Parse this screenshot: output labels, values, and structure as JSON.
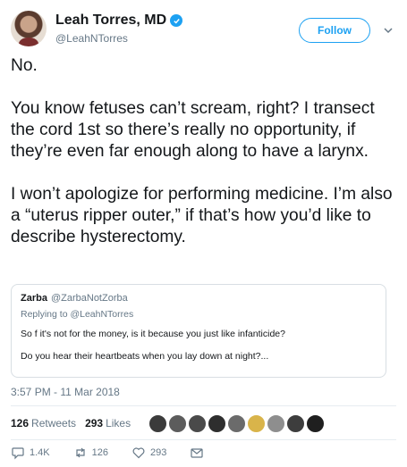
{
  "author": {
    "display_name": "Leah Torres, MD",
    "handle": "@LeahNTorres",
    "verified": true,
    "follow_label": "Follow"
  },
  "tweet": {
    "paragraphs": [
      "No.",
      "You know fetuses can’t scream, right? I transect the cord 1st so there’s really no opportunity, if they’re even far enough along to have a larynx.",
      "I won’t apologize for performing medicine. I’m also a “uterus ripper outer,” if that’s how you’d like to describe hysterectomy."
    ],
    "timestamp": "3:57 PM - 11 Mar 2018"
  },
  "quoted_tweet": {
    "display_name": "Zarba",
    "handle": "@ZarbaNotZorba",
    "replying_to": "Replying to @LeahNTorres",
    "line1": "So f it's not for the money, is it because you just like infanticide?",
    "line2": "Do you hear their heartbeats when you lay down at night?..."
  },
  "stats": {
    "retweets_count": "126",
    "retweets_label": "Retweets",
    "likes_count": "293",
    "likes_label": "Likes"
  },
  "actions": {
    "reply_count": "1.4K",
    "retweet_count": "126",
    "like_count": "293"
  },
  "colors": {
    "accent": "#1da1f2",
    "secondary_text": "#657786",
    "border": "#e6ecf0"
  },
  "liker_avatars": [
    "#3b3b3b",
    "#5c5c5c",
    "#4a4a4a",
    "#2e2e2e",
    "#6b6b6b",
    "#d9b44a",
    "#8e8e8e",
    "#3d3d3d",
    "#1f1f1f"
  ]
}
